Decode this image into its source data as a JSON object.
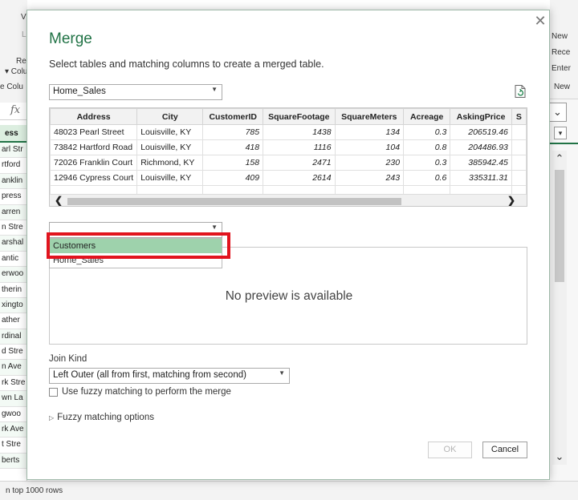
{
  "background": {
    "left_ribbon": [
      "V",
      "L",
      "Re",
      "▾ Colu",
      "e Colu"
    ],
    "right_ribbon": [
      "New",
      "Rece",
      "Enter",
      "New"
    ],
    "fx": "fx",
    "grid_header": "ess",
    "grid_rows": [
      "arl Str",
      "rtford",
      "anklin",
      "press",
      "arren",
      "n Stre",
      "arshal",
      "antic",
      "erwoo",
      "therin",
      "xingto",
      "ather",
      "rdinal",
      "d Stre",
      "n Ave",
      "rk Stre",
      "wn La",
      "gwoo",
      "rk Ave",
      "t Stre",
      "berts"
    ],
    "status": "n top 1000 rows"
  },
  "dialog": {
    "title": "Merge",
    "subtitle": "Select tables and matching columns to create a merged table.",
    "close_glyph": "✕",
    "first_table_select": "Home_Sales",
    "preview": {
      "columns": [
        "Address",
        "City",
        "CustomerID",
        "SquareFootage",
        "SquareMeters",
        "Acreage",
        "AskingPrice",
        "S"
      ],
      "rows": [
        [
          "48023 Pearl Street",
          "Louisville, KY",
          "785",
          "1438",
          "134",
          "0.3",
          "206519.46"
        ],
        [
          "73842 Hartford Road",
          "Louisville, KY",
          "418",
          "1116",
          "104",
          "0.8",
          "204486.93"
        ],
        [
          "72026 Franklin Court",
          "Richmond, KY",
          "158",
          "2471",
          "230",
          "0.3",
          "385942.45"
        ],
        [
          "12946 Cypress Court",
          "Louisville, KY",
          "409",
          "2614",
          "243",
          "0.6",
          "335311.31"
        ]
      ]
    },
    "second_table_select": "",
    "dropdown_options": [
      "Customers",
      "Home_Sales"
    ],
    "dropdown_selected": "Customers",
    "no_preview": "No preview is available",
    "join_kind_label": "Join Kind",
    "join_kind_value": "Left Outer (all from first, matching from second)",
    "fuzzy_checkbox_label": "Use fuzzy matching to perform the merge",
    "fuzzy_checkbox_checked": false,
    "fuzzy_options_label": "Fuzzy matching options",
    "ok_label": "OK",
    "cancel_label": "Cancel"
  }
}
